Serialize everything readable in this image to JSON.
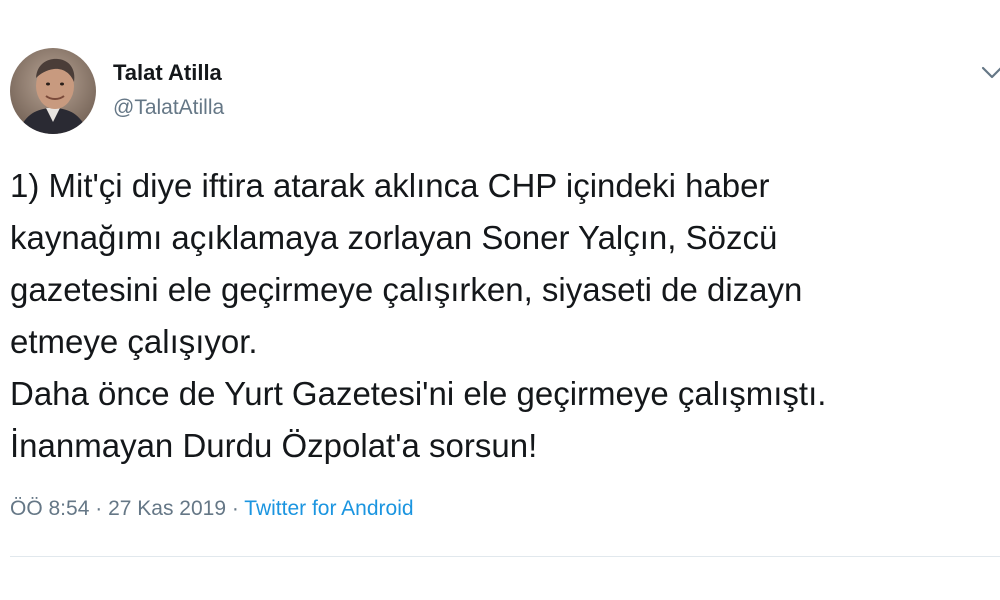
{
  "author": {
    "display_name": "Talat Atilla",
    "handle": "@TalatAtilla"
  },
  "tweet": {
    "lines": [
      "1) Mit'çi diye iftira atarak aklınca CHP içindeki haber",
      "kaynağımı açıklamaya zorlayan Soner Yalçın, Sözcü",
      "gazetesini ele geçirmeye çalışırken, siyaseti de dizayn",
      "etmeye çalışıyor.",
      "Daha önce de Yurt Gazetesi'ni ele geçirmeye çalışmıştı.",
      "İnanmayan Durdu Özpolat'a sorsun!"
    ]
  },
  "meta": {
    "time": "ÖÖ 8:54",
    "separator_1": " · ",
    "date": "27 Kas 2019",
    "separator_2": " · ",
    "source": "Twitter for Android"
  },
  "icons": {
    "caret": "chevron-down-icon"
  },
  "colors": {
    "text": "#14171a",
    "secondary": "#657786",
    "link": "#1b95e0",
    "divider": "#e1e8ed"
  }
}
